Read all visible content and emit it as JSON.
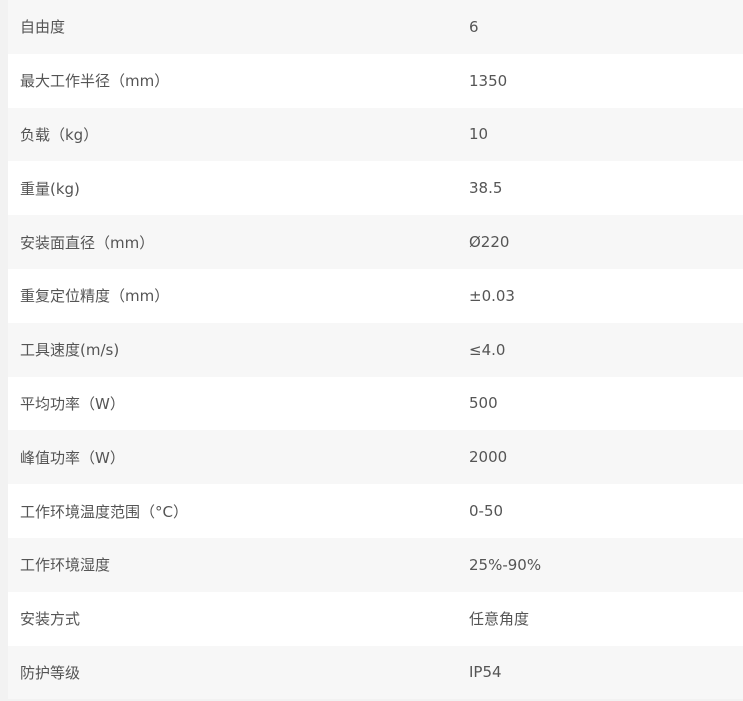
{
  "spec_table": {
    "rows": [
      {
        "label": "自由度",
        "value": "6"
      },
      {
        "label": "最大工作半径（mm）",
        "value": "1350"
      },
      {
        "label": "负载（kg）",
        "value": "10"
      },
      {
        "label": "重量(kg)",
        "value": "38.5"
      },
      {
        "label": "安装面直径（mm）",
        "value": "Ø220"
      },
      {
        "label": "重复定位精度（mm）",
        "value": "±0.03"
      },
      {
        "label": "工具速度(m/s)",
        "value": "≤4.0"
      },
      {
        "label": "平均功率（W）",
        "value": "500"
      },
      {
        "label": "峰值功率（W）",
        "value": "2000"
      },
      {
        "label": "工作环境温度范围（°C）",
        "value": "0-50"
      },
      {
        "label": "工作环境湿度",
        "value": "25%-90%"
      },
      {
        "label": "安装方式",
        "value": "任意角度"
      },
      {
        "label": "防护等级",
        "value": "IP54"
      }
    ]
  },
  "colors": {
    "page_bg": "#f2f2f2",
    "row_odd": "#f7f7f7",
    "row_even": "#ffffff",
    "text": "#555555"
  }
}
